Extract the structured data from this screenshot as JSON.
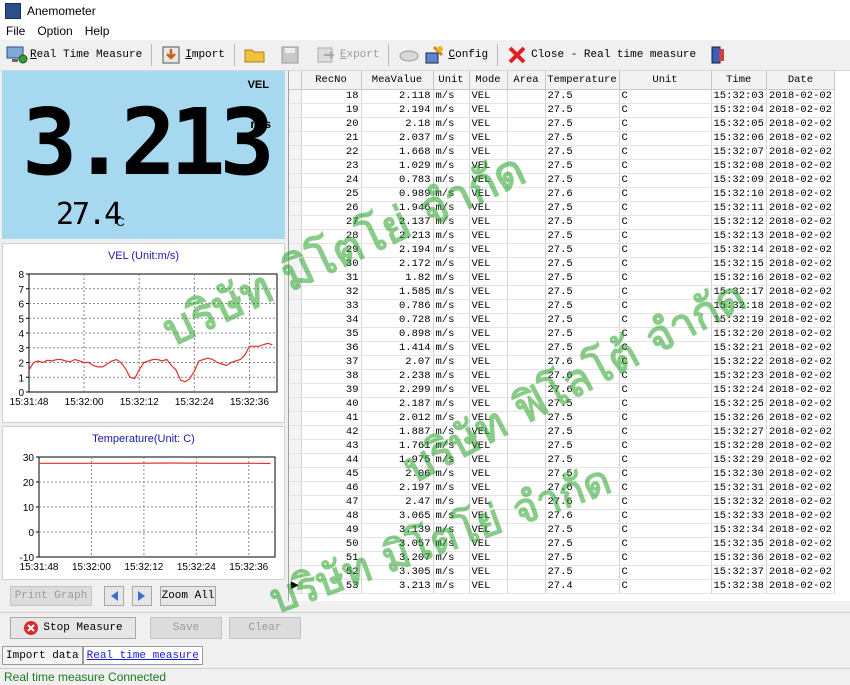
{
  "window": {
    "title": "Anemometer"
  },
  "menu": [
    "File",
    "Option",
    "Help"
  ],
  "toolbar": {
    "realtime_u": "R",
    "realtime_rest": "eal Time Measure",
    "import_u": "I",
    "import_rest": "mport",
    "export_u": "E",
    "export_rest": "xport",
    "config_u": "C",
    "config_rest": "onfig",
    "close_label": "Close - Real time measure"
  },
  "lcd": {
    "mode": "VEL",
    "unit": "m/s",
    "value": "3.213",
    "temp": "27.4",
    "temp_unit": "C"
  },
  "controls": {
    "print_graph": "Print Graph",
    "zoom_all": "Zoom All",
    "stop_measure": "Stop Measure",
    "save": "Save",
    "clear": "Clear"
  },
  "tabs": [
    "Import data",
    "Real time measure"
  ],
  "status": "Real time measure Connected",
  "watermarks": [
    "บริษัท มิโตโย่ จำกัด",
    "บริษัท ฟิโลโต้ จำกัด",
    "บริษัท มิโตโย่ จำกัด"
  ],
  "colors": {
    "lcd_bg": "#a6d8f0",
    "trace": "#e0302a",
    "title_blue": "#1a1aa8",
    "status_green": "#1c7a1c"
  },
  "table": {
    "headers": [
      "RecNo",
      "MeaValue",
      "Unit",
      "Mode",
      "Area",
      "Temperature",
      "Unit",
      "Time",
      "Date"
    ],
    "rows": [
      [
        "18",
        "2.118",
        "m/s",
        "VEL",
        "",
        "27.5",
        "C",
        "15:32:03",
        "2018-02-02"
      ],
      [
        "19",
        "2.194",
        "m/s",
        "VEL",
        "",
        "27.5",
        "C",
        "15:32:04",
        "2018-02-02"
      ],
      [
        "20",
        "2.18",
        "m/s",
        "VEL",
        "",
        "27.5",
        "C",
        "15:32:05",
        "2018-02-02"
      ],
      [
        "21",
        "2.037",
        "m/s",
        "VEL",
        "",
        "27.5",
        "C",
        "15:32:06",
        "2018-02-02"
      ],
      [
        "22",
        "1.668",
        "m/s",
        "VEL",
        "",
        "27.5",
        "C",
        "15:32:07",
        "2018-02-02"
      ],
      [
        "23",
        "1.029",
        "m/s",
        "VEL",
        "",
        "27.5",
        "C",
        "15:32:08",
        "2018-02-02"
      ],
      [
        "24",
        "0.783",
        "m/s",
        "VEL",
        "",
        "27.5",
        "C",
        "15:32:09",
        "2018-02-02"
      ],
      [
        "25",
        "0.989",
        "m/s",
        "VEL",
        "",
        "27.6",
        "C",
        "15:32:10",
        "2018-02-02"
      ],
      [
        "26",
        "1.946",
        "m/s",
        "VEL",
        "",
        "27.5",
        "C",
        "15:32:11",
        "2018-02-02"
      ],
      [
        "27",
        "2.137",
        "m/s",
        "VEL",
        "",
        "27.5",
        "C",
        "15:32:12",
        "2018-02-02"
      ],
      [
        "28",
        "2.213",
        "m/s",
        "VEL",
        "",
        "27.5",
        "C",
        "15:32:13",
        "2018-02-02"
      ],
      [
        "29",
        "2.194",
        "m/s",
        "VEL",
        "",
        "27.5",
        "C",
        "15:32:14",
        "2018-02-02"
      ],
      [
        "30",
        "2.172",
        "m/s",
        "VEL",
        "",
        "27.5",
        "C",
        "15:32:15",
        "2018-02-02"
      ],
      [
        "31",
        "1.82",
        "m/s",
        "VEL",
        "",
        "27.5",
        "C",
        "15:32:16",
        "2018-02-02"
      ],
      [
        "32",
        "1.585",
        "m/s",
        "VEL",
        "",
        "27.5",
        "C",
        "15:32:17",
        "2018-02-02"
      ],
      [
        "33",
        "0.786",
        "m/s",
        "VEL",
        "",
        "27.5",
        "C",
        "15:32:18",
        "2018-02-02"
      ],
      [
        "34",
        "0.728",
        "m/s",
        "VEL",
        "",
        "27.5",
        "C",
        "15:32:19",
        "2018-02-02"
      ],
      [
        "35",
        "0.898",
        "m/s",
        "VEL",
        "",
        "27.5",
        "C",
        "15:32:20",
        "2018-02-02"
      ],
      [
        "36",
        "1.414",
        "m/s",
        "VEL",
        "",
        "27.5",
        "C",
        "15:32:21",
        "2018-02-02"
      ],
      [
        "37",
        "2.07",
        "m/s",
        "VEL",
        "",
        "27.6",
        "C",
        "15:32:22",
        "2018-02-02"
      ],
      [
        "38",
        "2.238",
        "m/s",
        "VEL",
        "",
        "27.6",
        "C",
        "15:32:23",
        "2018-02-02"
      ],
      [
        "39",
        "2.299",
        "m/s",
        "VEL",
        "",
        "27.6",
        "C",
        "15:32:24",
        "2018-02-02"
      ],
      [
        "40",
        "2.187",
        "m/s",
        "VEL",
        "",
        "27.5",
        "C",
        "15:32:25",
        "2018-02-02"
      ],
      [
        "41",
        "2.012",
        "m/s",
        "VEL",
        "",
        "27.5",
        "C",
        "15:32:26",
        "2018-02-02"
      ],
      [
        "42",
        "1.887",
        "m/s",
        "VEL",
        "",
        "27.5",
        "C",
        "15:32:27",
        "2018-02-02"
      ],
      [
        "43",
        "1.761",
        "m/s",
        "VEL",
        "",
        "27.5",
        "C",
        "15:32:28",
        "2018-02-02"
      ],
      [
        "44",
        "1.975",
        "m/s",
        "VEL",
        "",
        "27.5",
        "C",
        "15:32:29",
        "2018-02-02"
      ],
      [
        "45",
        "2.06",
        "m/s",
        "VEL",
        "",
        "27.5",
        "C",
        "15:32:30",
        "2018-02-02"
      ],
      [
        "46",
        "2.197",
        "m/s",
        "VEL",
        "",
        "27.6",
        "C",
        "15:32:31",
        "2018-02-02"
      ],
      [
        "47",
        "2.47",
        "m/s",
        "VEL",
        "",
        "27.6",
        "C",
        "15:32:32",
        "2018-02-02"
      ],
      [
        "48",
        "3.065",
        "m/s",
        "VEL",
        "",
        "27.6",
        "C",
        "15:32:33",
        "2018-02-02"
      ],
      [
        "49",
        "3.139",
        "m/s",
        "VEL",
        "",
        "27.5",
        "C",
        "15:32:34",
        "2018-02-02"
      ],
      [
        "50",
        "3.057",
        "m/s",
        "VEL",
        "",
        "27.5",
        "C",
        "15:32:35",
        "2018-02-02"
      ],
      [
        "51",
        "3.207",
        "m/s",
        "VEL",
        "",
        "27.5",
        "C",
        "15:32:36",
        "2018-02-02"
      ],
      [
        "52",
        "3.305",
        "m/s",
        "VEL",
        "",
        "27.5",
        "C",
        "15:32:37",
        "2018-02-02"
      ],
      [
        "53",
        "3.213",
        "m/s",
        "VEL",
        "",
        "27.4",
        "C",
        "15:32:38",
        "2018-02-02"
      ]
    ]
  },
  "chart_data": [
    {
      "type": "line",
      "title": "VEL  (Unit:m/s)",
      "ylim": [
        0,
        8
      ],
      "yticks": [
        "0",
        "1",
        "2",
        "3",
        "4",
        "5",
        "6",
        "7",
        "8"
      ],
      "xticks": [
        "15:31:48",
        "15:32:00",
        "15:32:12",
        "15:32:24",
        "15:32:36"
      ],
      "xlim_seconds": [
        0,
        54
      ],
      "grid": true,
      "series": [
        {
          "x": [
            0,
            1,
            2,
            3,
            4,
            5,
            6,
            7,
            8,
            9,
            10,
            11,
            12,
            13,
            14,
            15,
            16,
            17,
            18,
            19,
            20,
            21,
            22,
            23,
            24,
            25,
            26,
            27,
            28,
            29,
            30,
            31,
            32,
            33,
            34,
            35,
            36,
            37,
            38,
            39,
            40,
            41,
            42,
            43,
            44,
            45,
            46,
            47,
            48,
            49,
            50,
            51,
            52,
            53
          ],
          "y": [
            1.5,
            2.0,
            2.1,
            2.0,
            2.15,
            2.1,
            2.2,
            2.2,
            2.1,
            2.05,
            2.2,
            2.1,
            2.0,
            2.0,
            1.8,
            1.7,
            1.7,
            1.9,
            2.1,
            2.2,
            2.0,
            1.6,
            1.0,
            0.9,
            1.5,
            2.0,
            2.1,
            2.2,
            2.2,
            2.1,
            2.2,
            1.8,
            1.5,
            0.8,
            0.7,
            0.9,
            1.4,
            2.1,
            2.2,
            2.3,
            2.2,
            2.0,
            1.9,
            1.8,
            2.0,
            2.1,
            2.2,
            2.5,
            3.1,
            3.1,
            3.1,
            3.2,
            3.3,
            3.2
          ]
        }
      ]
    },
    {
      "type": "line",
      "title": "Temperature(Unit: C)",
      "ylim": [
        -10,
        30
      ],
      "yticks": [
        "-10",
        "0",
        "10",
        "20",
        "30"
      ],
      "xticks": [
        "15:31:48",
        "15:32:00",
        "15:32:12",
        "15:32:24",
        "15:32:36"
      ],
      "xlim_seconds": [
        0,
        54
      ],
      "grid": true,
      "series": [
        {
          "x": [
            0,
            10,
            20,
            30,
            40,
            50,
            53
          ],
          "y": [
            27.5,
            27.5,
            27.5,
            27.6,
            27.5,
            27.5,
            27.4
          ]
        }
      ]
    }
  ]
}
